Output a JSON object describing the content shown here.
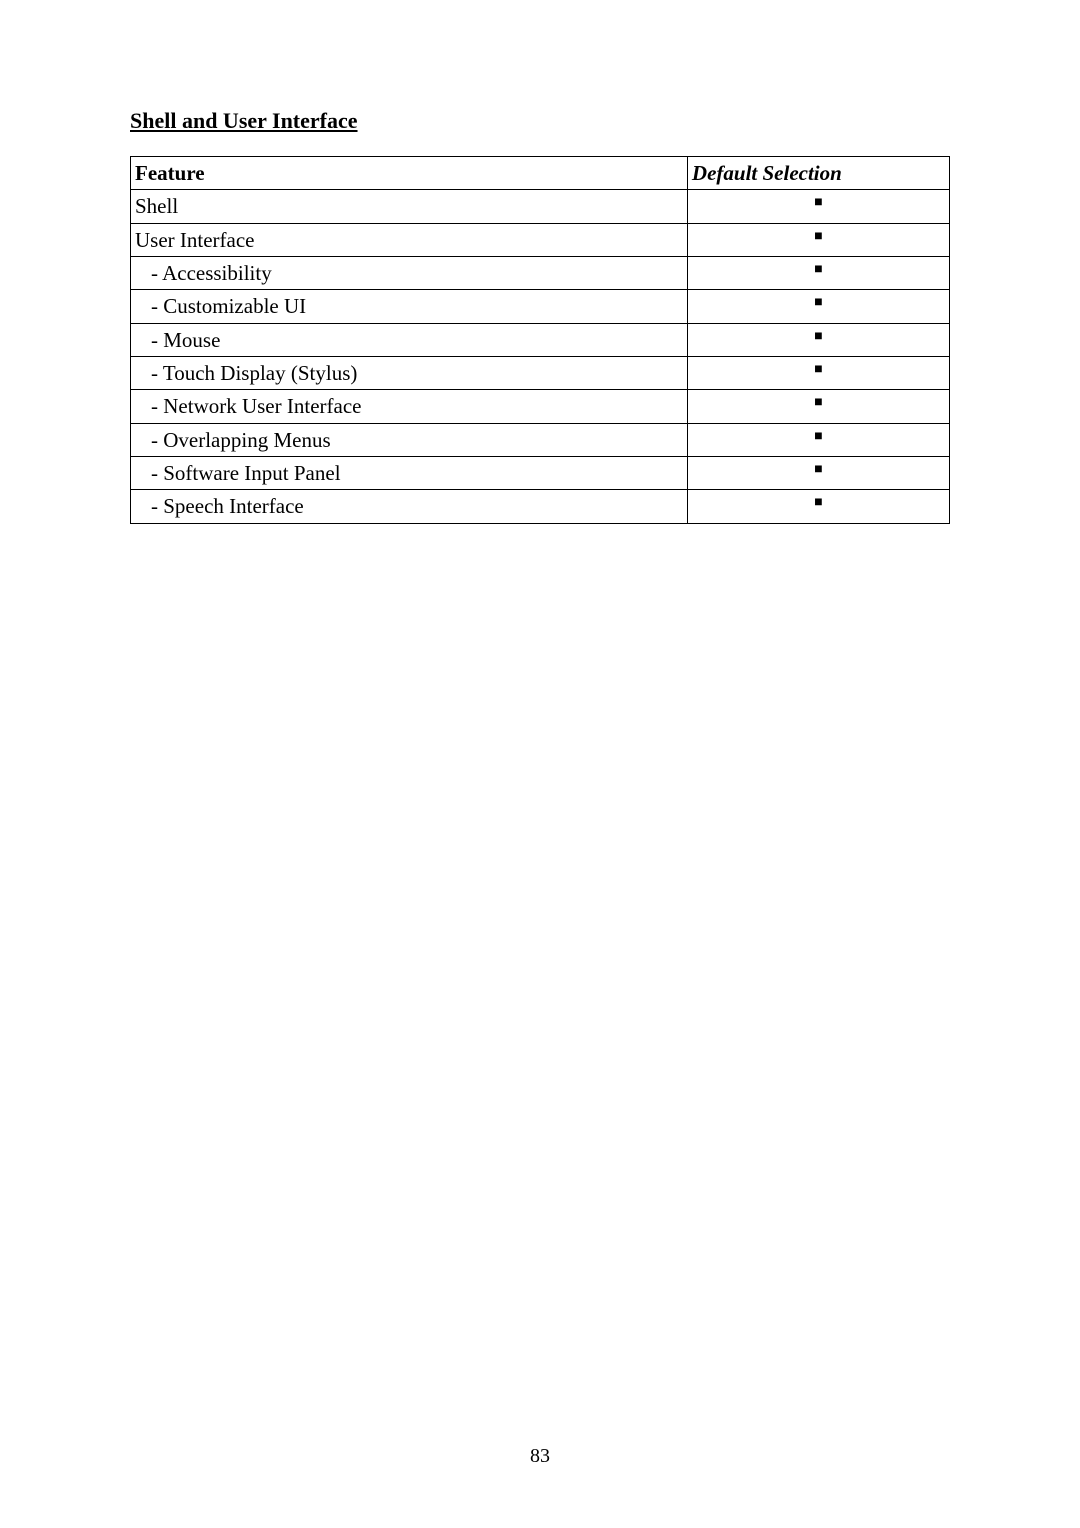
{
  "heading": "Shell and User Interface",
  "columns": {
    "feature": "Feature",
    "default": "Default Selection"
  },
  "mark_glyph": "■",
  "rows": [
    {
      "label": "Shell",
      "indent": 0,
      "selected": true
    },
    {
      "label": "User Interface",
      "indent": 0,
      "selected": true
    },
    {
      "label": "- Accessibility",
      "indent": 1,
      "selected": true
    },
    {
      "label": "- Customizable UI",
      "indent": 1,
      "selected": true
    },
    {
      "label": "- Mouse",
      "indent": 1,
      "selected": true
    },
    {
      "label": "- Touch Display (Stylus)",
      "indent": 1,
      "selected": true
    },
    {
      "label": "- Network User Interface",
      "indent": 1,
      "selected": true
    },
    {
      "label": "- Overlapping Menus",
      "indent": 1,
      "selected": true
    },
    {
      "label": "- Software Input Panel",
      "indent": 1,
      "selected": true
    },
    {
      "label": "- Speech Interface",
      "indent": 1,
      "selected": true
    }
  ],
  "page_number": "83"
}
